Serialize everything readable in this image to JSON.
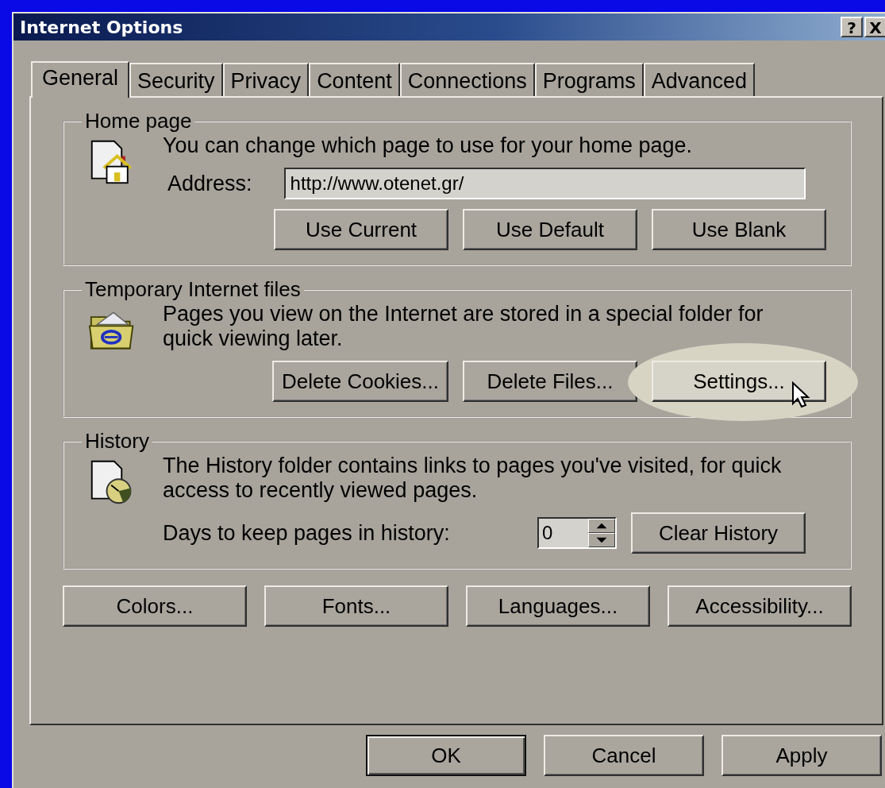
{
  "window": {
    "title": "Internet Options",
    "help": "?",
    "close": "X"
  },
  "tabs": [
    {
      "label": "General",
      "selected": true
    },
    {
      "label": "Security",
      "selected": false
    },
    {
      "label": "Privacy",
      "selected": false
    },
    {
      "label": "Content",
      "selected": false
    },
    {
      "label": "Connections",
      "selected": false
    },
    {
      "label": "Programs",
      "selected": false
    },
    {
      "label": "Advanced",
      "selected": false
    }
  ],
  "groups": [
    {
      "kind": "home",
      "title": "Home page",
      "description": "You can change which page to use for your home page.",
      "field": {
        "kind": "text",
        "label": "Address:",
        "value": "http://www.otenet.gr/"
      },
      "buttons": [
        {
          "label": "Use Current",
          "highlighted": false
        },
        {
          "label": "Use Default",
          "highlighted": false
        },
        {
          "label": "Use Blank",
          "highlighted": false
        }
      ]
    },
    {
      "kind": "temp",
      "title": "Temporary Internet files",
      "description": "Pages you view on the Internet are stored in a special folder for quick viewing later.",
      "buttons": [
        {
          "label": "Delete Cookies...",
          "highlighted": false
        },
        {
          "label": "Delete Files...",
          "highlighted": false
        },
        {
          "label": "Settings...",
          "highlighted": true
        }
      ]
    },
    {
      "kind": "history",
      "title": "History",
      "description": "The History folder contains links to pages you've visited, for quick access to recently viewed pages.",
      "field": {
        "kind": "spin",
        "label": "Days to keep pages in history:",
        "value": "0"
      },
      "buttons": [
        {
          "label": "Clear History",
          "highlighted": false
        }
      ]
    }
  ],
  "panel_buttons": [
    "Colors...",
    "Fonts...",
    "Languages...",
    "Accessibility..."
  ],
  "dialog_buttons": [
    {
      "label": "OK",
      "default": true
    },
    {
      "label": "Cancel",
      "default": false
    },
    {
      "label": "Apply",
      "default": false
    }
  ]
}
